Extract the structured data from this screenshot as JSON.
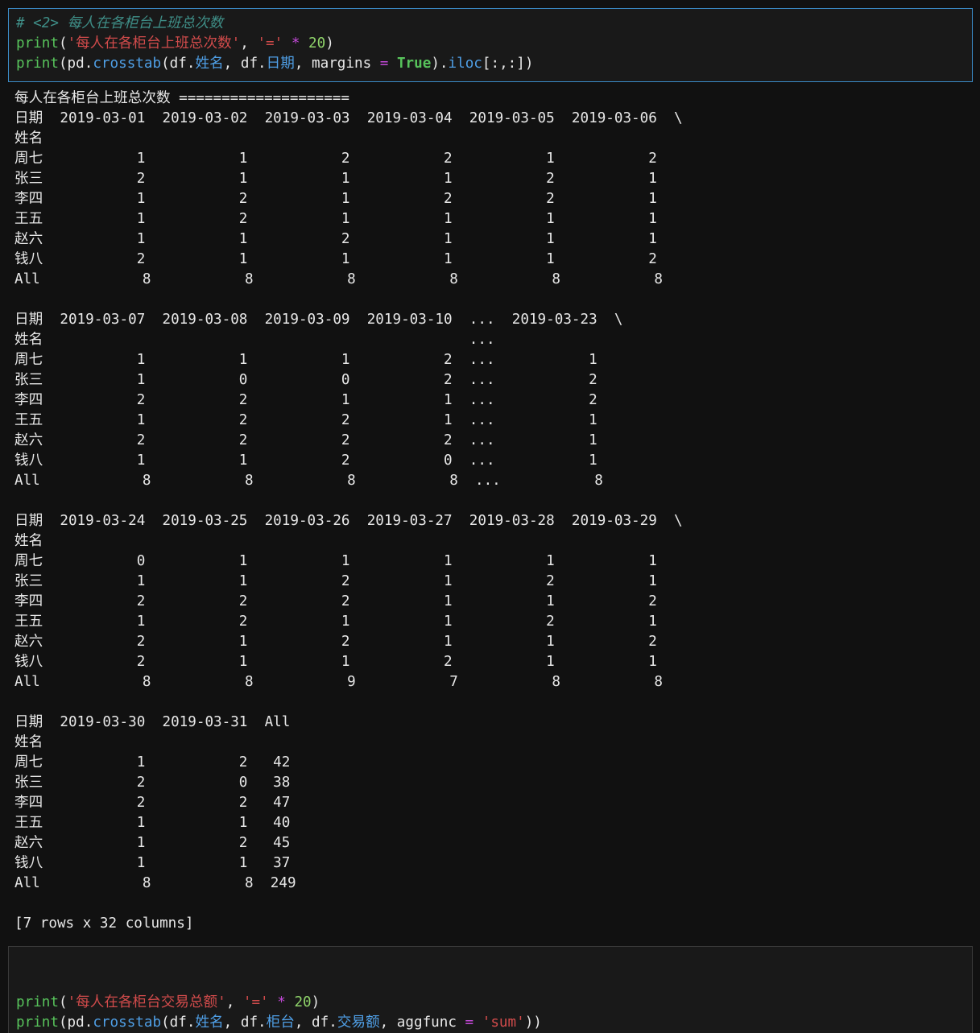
{
  "cells": [
    {
      "id": "cell1",
      "lines": [
        [
          {
            "t": "# <2> 每人在各柜台上班总次数",
            "c": "comment"
          }
        ],
        [
          {
            "t": "print",
            "c": "func"
          },
          {
            "t": "(",
            "c": "punc"
          },
          {
            "t": "'每人在各柜台上班总次数'",
            "c": "str"
          },
          {
            "t": ", ",
            "c": "punc"
          },
          {
            "t": "'='",
            "c": "str"
          },
          {
            "t": " ",
            "c": "punc"
          },
          {
            "t": "*",
            "c": "op"
          },
          {
            "t": " ",
            "c": "punc"
          },
          {
            "t": "20",
            "c": "num"
          },
          {
            "t": ")",
            "c": "punc"
          }
        ],
        [
          {
            "t": "print",
            "c": "func"
          },
          {
            "t": "(pd.",
            "c": "punc"
          },
          {
            "t": "crosstab",
            "c": "attr"
          },
          {
            "t": "(df.",
            "c": "punc"
          },
          {
            "t": "姓名",
            "c": "attr"
          },
          {
            "t": ", df.",
            "c": "punc"
          },
          {
            "t": "日期",
            "c": "attr"
          },
          {
            "t": ", margins ",
            "c": "punc"
          },
          {
            "t": "=",
            "c": "op"
          },
          {
            "t": " ",
            "c": "punc"
          },
          {
            "t": "True",
            "c": "kw"
          },
          {
            "t": ").",
            "c": "punc"
          },
          {
            "t": "iloc",
            "c": "attr"
          },
          {
            "t": "[:,:])",
            "c": "punc"
          }
        ]
      ]
    },
    {
      "id": "cell2",
      "lines": [
        [
          {
            "t": "print",
            "c": "func"
          },
          {
            "t": "(",
            "c": "punc"
          },
          {
            "t": "'每人在各柜台交易总额'",
            "c": "str"
          },
          {
            "t": ", ",
            "c": "punc"
          },
          {
            "t": "'='",
            "c": "str"
          },
          {
            "t": " ",
            "c": "punc"
          },
          {
            "t": "*",
            "c": "op"
          },
          {
            "t": " ",
            "c": "punc"
          },
          {
            "t": "20",
            "c": "num"
          },
          {
            "t": ")",
            "c": "punc"
          }
        ],
        [
          {
            "t": "print",
            "c": "func"
          },
          {
            "t": "(pd.",
            "c": "punc"
          },
          {
            "t": "crosstab",
            "c": "attr"
          },
          {
            "t": "(df.",
            "c": "punc"
          },
          {
            "t": "姓名",
            "c": "attr"
          },
          {
            "t": ", df.",
            "c": "punc"
          },
          {
            "t": "柜台",
            "c": "attr"
          },
          {
            "t": ", df.",
            "c": "punc"
          },
          {
            "t": "交易额",
            "c": "attr"
          },
          {
            "t": ", aggfunc ",
            "c": "punc"
          },
          {
            "t": "=",
            "c": "op"
          },
          {
            "t": " ",
            "c": "punc"
          },
          {
            "t": "'sum'",
            "c": "str"
          },
          {
            "t": "))",
            "c": "punc"
          }
        ]
      ]
    }
  ],
  "output": {
    "lines": [
      "每人在各柜台上班总次数 ====================",
      "日期  2019-03-01  2019-03-02  2019-03-03  2019-03-04  2019-03-05  2019-03-06  \\",
      "姓名",
      "周七           1           1           2           2           1           2",
      "张三           2           1           1           1           2           1",
      "李四           1           2           1           2           2           1",
      "王五           1           2           1           1           1           1",
      "赵六           1           1           2           1           1           1",
      "钱八           2           1           1           1           1           2",
      "All            8           8           8           8           8           8",
      "",
      "日期  2019-03-07  2019-03-08  2019-03-09  2019-03-10  ...  2019-03-23  \\",
      "姓名                                                  ...",
      "周七           1           1           1           2  ...           1",
      "张三           1           0           0           2  ...           2",
      "李四           2           2           1           1  ...           2",
      "王五           1           2           2           1  ...           1",
      "赵六           2           2           2           2  ...           1",
      "钱八           1           1           2           0  ...           1",
      "All            8           8           8           8  ...           8",
      "",
      "日期  2019-03-24  2019-03-25  2019-03-26  2019-03-27  2019-03-28  2019-03-29  \\",
      "姓名",
      "周七           0           1           1           1           1           1",
      "张三           1           1           2           1           2           1",
      "李四           2           2           2           1           1           2",
      "王五           1           2           1           1           2           1",
      "赵六           2           1           2           1           1           2",
      "钱八           2           1           1           2           1           1",
      "All            8           8           9           7           8           8",
      "",
      "日期  2019-03-30  2019-03-31  All",
      "姓名",
      "周七           1           2   42",
      "张三           2           0   38",
      "李四           2           2   47",
      "王五           1           1   40",
      "赵六           1           2   45",
      "钱八           1           1   37",
      "All            8           8  249",
      "",
      "[7 rows x 32 columns]"
    ]
  }
}
